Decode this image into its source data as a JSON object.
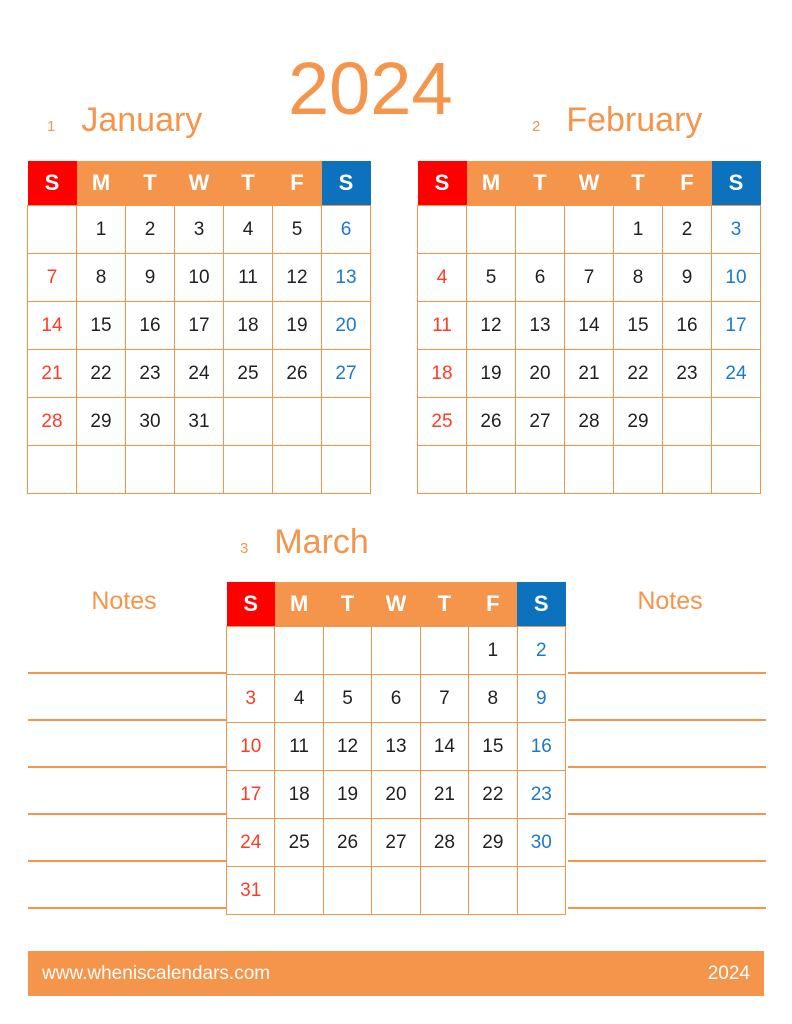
{
  "year_label": "2024",
  "colors": {
    "orange": "#F4954B",
    "sunday_header_bg": "#FF0000",
    "saturday_header_bg": "#0C72BE",
    "sunday_date": "#FF3B24",
    "saturday_date": "#1B79C8",
    "weekday_date": "#231F20"
  },
  "weekday_headers": [
    "S",
    "M",
    "T",
    "W",
    "T",
    "F",
    "S"
  ],
  "months": [
    {
      "number": "1",
      "name": "January",
      "weeks": [
        [
          "",
          "1",
          "2",
          "3",
          "4",
          "5",
          "6"
        ],
        [
          "7",
          "8",
          "9",
          "10",
          "11",
          "12",
          "13"
        ],
        [
          "14",
          "15",
          "16",
          "17",
          "18",
          "19",
          "20"
        ],
        [
          "21",
          "22",
          "23",
          "24",
          "25",
          "26",
          "27"
        ],
        [
          "28",
          "29",
          "30",
          "31",
          "",
          "",
          ""
        ],
        [
          "",
          "",
          "",
          "",
          "",
          "",
          ""
        ]
      ]
    },
    {
      "number": "2",
      "name": "February",
      "weeks": [
        [
          "",
          "",
          "",
          "",
          "1",
          "2",
          "3"
        ],
        [
          "4",
          "5",
          "6",
          "7",
          "8",
          "9",
          "10"
        ],
        [
          "11",
          "12",
          "13",
          "14",
          "15",
          "16",
          "17"
        ],
        [
          "18",
          "19",
          "20",
          "21",
          "22",
          "23",
          "24"
        ],
        [
          "25",
          "26",
          "27",
          "28",
          "29",
          "",
          ""
        ],
        [
          "",
          "",
          "",
          "",
          "",
          "",
          ""
        ]
      ]
    },
    {
      "number": "3",
      "name": "March",
      "weeks": [
        [
          "",
          "",
          "",
          "",
          "",
          "1",
          "2"
        ],
        [
          "3",
          "4",
          "5",
          "6",
          "7",
          "8",
          "9"
        ],
        [
          "10",
          "11",
          "12",
          "13",
          "14",
          "15",
          "16"
        ],
        [
          "17",
          "18",
          "19",
          "20",
          "21",
          "22",
          "23"
        ],
        [
          "24",
          "25",
          "26",
          "27",
          "28",
          "29",
          "30"
        ],
        [
          "31",
          "",
          "",
          "",
          "",
          "",
          ""
        ]
      ]
    }
  ],
  "notes": {
    "left_label": "Notes",
    "right_label": "Notes",
    "rule_count": 6
  },
  "footer": {
    "site": "www.wheniscalendars.com",
    "year": "2024"
  }
}
